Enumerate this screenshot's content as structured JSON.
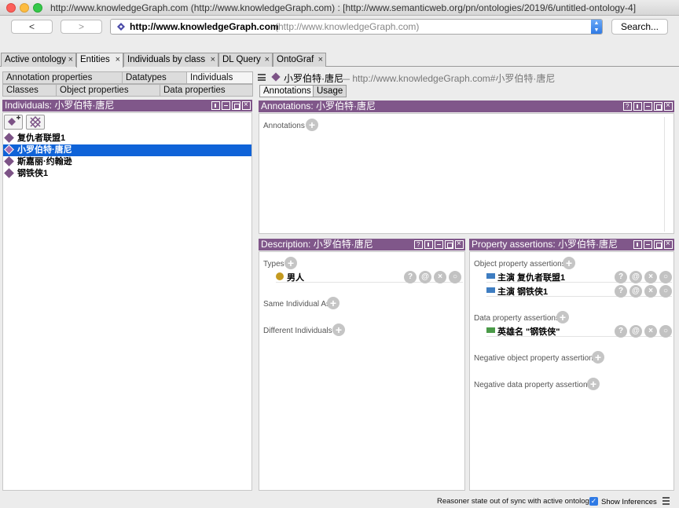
{
  "window": {
    "title": "http://www.knowledgeGraph.com (http://www.knowledgeGraph.com)  : [http://www.semanticweb.org/pn/ontologies/2019/6/untitled-ontology-4]"
  },
  "nav": {
    "back_label": "<",
    "forward_label": ">",
    "url_main": "http://www.knowledgeGraph.com",
    "url_sub": "(http://www.knowledgeGraph.com)",
    "search_label": "Search..."
  },
  "workspace_tabs": [
    {
      "label": "Active ontology",
      "close": "×"
    },
    {
      "label": "Entities",
      "close": "×"
    },
    {
      "label": "Individuals by class",
      "close": "×"
    },
    {
      "label": "DL Query",
      "close": "×"
    },
    {
      "label": "OntoGraf",
      "close": "×"
    }
  ],
  "entity_tabs": [
    "Annotation properties",
    "Datatypes",
    "Individuals",
    "Classes",
    "Object properties",
    "Data properties"
  ],
  "individuals_panel": {
    "title": "Individuals: 小罗伯特·唐尼",
    "items": [
      "复仇者联盟1",
      "小罗伯特·唐尼",
      "斯嘉丽·约翰逊",
      "钢铁侠1"
    ]
  },
  "breadcrumb": {
    "name": "小罗伯特·唐尼",
    "iri": "— http://www.knowledgeGraph.com#小罗伯特·唐尼"
  },
  "right_tabs": [
    "Annotations",
    "Usage"
  ],
  "annotations_panel": {
    "title": "Annotations: 小罗伯特·唐尼",
    "section": "Annotations"
  },
  "description_panel": {
    "title": "Description: 小罗伯特·唐尼",
    "types_label": "Types",
    "types": [
      "男人"
    ],
    "same_label": "Same Individual As",
    "different_label": "Different Individuals"
  },
  "property_panel": {
    "title": "Property assertions: 小罗伯特·唐尼",
    "object_label": "Object property assertions",
    "object_assertions": [
      "主演  复仇者联盟1",
      "主演  钢铁侠1"
    ],
    "data_label": "Data property assertions",
    "data_assertions": [
      "英雄名  \"钢铁侠\""
    ],
    "neg_object_label": "Negative object property assertions",
    "neg_data_label": "Negative data property assertions"
  },
  "row_actions": [
    "?",
    "@",
    "×",
    "○"
  ],
  "status": {
    "message": "Reasoner state out of sync with active ontology",
    "show_inferences": "Show Inferences"
  }
}
